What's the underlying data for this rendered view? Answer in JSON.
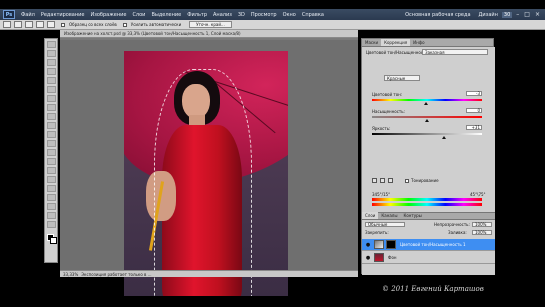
{
  "app": {
    "logo": "Ps",
    "menu": [
      "Файл",
      "Редактирование",
      "Изображение",
      "Слои",
      "Выделение",
      "Фильтр",
      "Анализ",
      "3D",
      "Просмотр",
      "Окно",
      "Справка"
    ],
    "workspace": "Основная рабочая среда",
    "cs_live": "Дизайн",
    "badge": "30",
    "window_controls": [
      "–",
      "□",
      "×"
    ]
  },
  "options": {
    "checkbox1_label": "Образец со всех слоёв",
    "checkbox2_label": "Усилить автоматически",
    "refine_button": "Уточн. край..."
  },
  "document": {
    "tab_title": "Изображение на холст.psd @ 33,3% (Цветовой тон/Насыщенность 1, Слой маска/8)",
    "status_zoom": "33,33%",
    "status_text": "Экспозиция работает только в ..."
  },
  "panels": {
    "top_tabs": [
      "Маски",
      "Коррекция",
      "Инфо"
    ],
    "hue_sat": {
      "title": "Цветовой тон/Насыщенность",
      "preset": "Заказная",
      "channel": "Красные",
      "hue_label": "Цветовой тон:",
      "hue_value": "-3",
      "hue_level": 0.49,
      "sat_label": "Насыщенность:",
      "sat_value": "0",
      "sat_level": 0.5,
      "light_label": "Яркость:",
      "light_value": "+31",
      "light_level": 0.65,
      "colorize_label": "Тонирование",
      "range_left": "345°/15°",
      "range_right": "45°\\75°"
    },
    "layers": {
      "tabs": [
        "Слои",
        "Каналы",
        "Контуры"
      ],
      "blend_mode": "Обычные",
      "opacity_label": "Непрозрачность:",
      "opacity_value": "100%",
      "lock_label": "Закрепить:",
      "fill_label": "Заливка:",
      "fill_value": "100%",
      "rows": [
        {
          "name": "Цветовой тон/Насыщенность 1",
          "selected": true
        },
        {
          "name": "Фон",
          "selected": false
        }
      ]
    }
  },
  "watermark": "© 2011 Евгений Карташов"
}
